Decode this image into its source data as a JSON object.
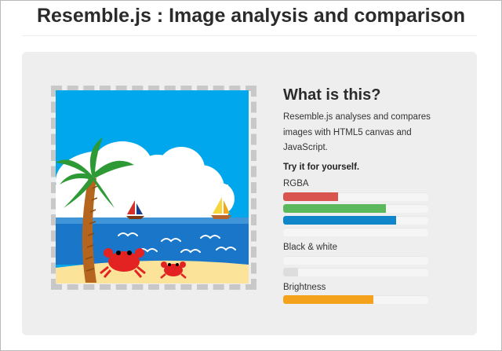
{
  "page": {
    "title": "Resemble.js : Image analysis and comparison"
  },
  "info": {
    "heading": "What is this?",
    "description": "Resemble.js analyses and compares images with HTML5 canvas and JavaScript.",
    "cta": "Try it for yourself."
  },
  "analysis": {
    "rgba": {
      "label": "RGBA",
      "bars": [
        {
          "channel": "red",
          "fraction": 0.38,
          "color": "#d9534f"
        },
        {
          "channel": "green",
          "fraction": 0.71,
          "color": "#5cb85c"
        },
        {
          "channel": "blue",
          "fraction": 0.78,
          "color": "#0e86c9"
        },
        {
          "channel": "alpha",
          "fraction": 0.0,
          "color": "#cccccc"
        }
      ]
    },
    "bw": {
      "label": "Black & white",
      "bars": [
        {
          "channel": "white",
          "fraction": 0.0,
          "color": "#ffffff"
        },
        {
          "channel": "black",
          "fraction": 0.1,
          "color": "#dddddd"
        }
      ]
    },
    "brightness": {
      "label": "Brightness",
      "bars": [
        {
          "channel": "brightness",
          "fraction": 0.62,
          "color": "#f4a21c"
        }
      ]
    }
  },
  "image": {
    "icon": "beach-scene-image",
    "colors": {
      "sky": "#00a7ec",
      "sea": "#1a76c8",
      "sand": "#fbe39a",
      "crab": "#e32222"
    }
  }
}
